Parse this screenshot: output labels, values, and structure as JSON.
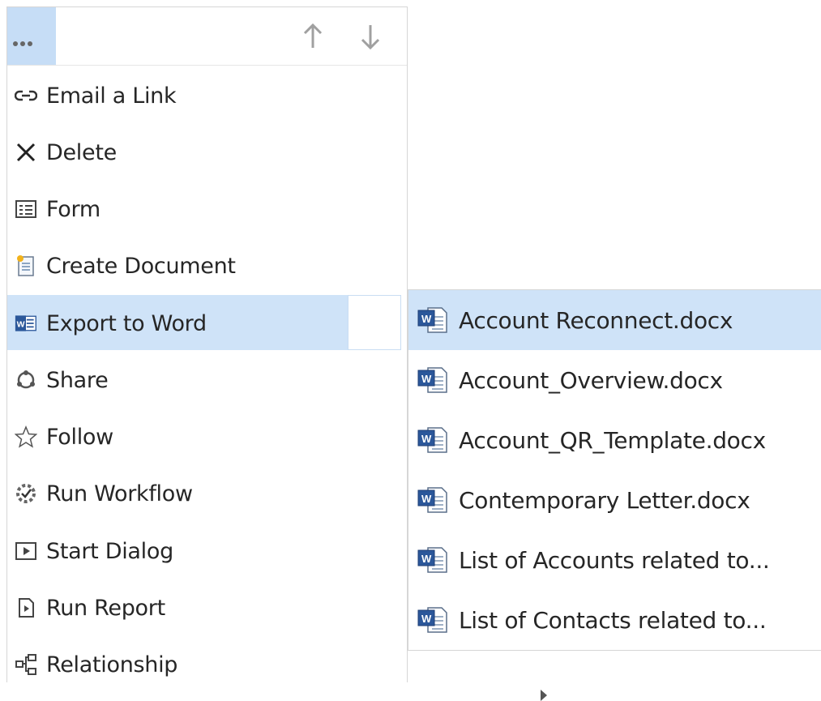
{
  "menu": {
    "items": [
      {
        "label": "Email a Link",
        "icon": "link-icon"
      },
      {
        "label": "Delete",
        "icon": "close-icon"
      },
      {
        "label": "Form",
        "icon": "form-icon"
      },
      {
        "label": "Create Document",
        "icon": "new-document-icon"
      },
      {
        "label": "Export to Word",
        "icon": "word-icon",
        "has_submenu": true,
        "active": true
      },
      {
        "label": "Share",
        "icon": "share-icon"
      },
      {
        "label": "Follow",
        "icon": "star-icon"
      },
      {
        "label": "Run Workflow",
        "icon": "workflow-icon"
      },
      {
        "label": "Start Dialog",
        "icon": "play-icon"
      },
      {
        "label": "Run Report",
        "icon": "report-icon",
        "has_submenu": true
      },
      {
        "label": "Relationship",
        "icon": "relationship-icon",
        "has_submenu": true
      }
    ]
  },
  "submenu": {
    "items": [
      {
        "label": "Account Reconnect.docx",
        "highlighted": true
      },
      {
        "label": "Account_Overview.docx"
      },
      {
        "label": "Account_QR_Template.docx"
      },
      {
        "label": "Contemporary Letter.docx"
      },
      {
        "label": "List of Accounts related to..."
      },
      {
        "label": "List of Contacts related to..."
      }
    ]
  },
  "colors": {
    "highlight": "#cfe3f8",
    "more_button": "#c6ddf6",
    "word_blue": "#2b579a"
  }
}
